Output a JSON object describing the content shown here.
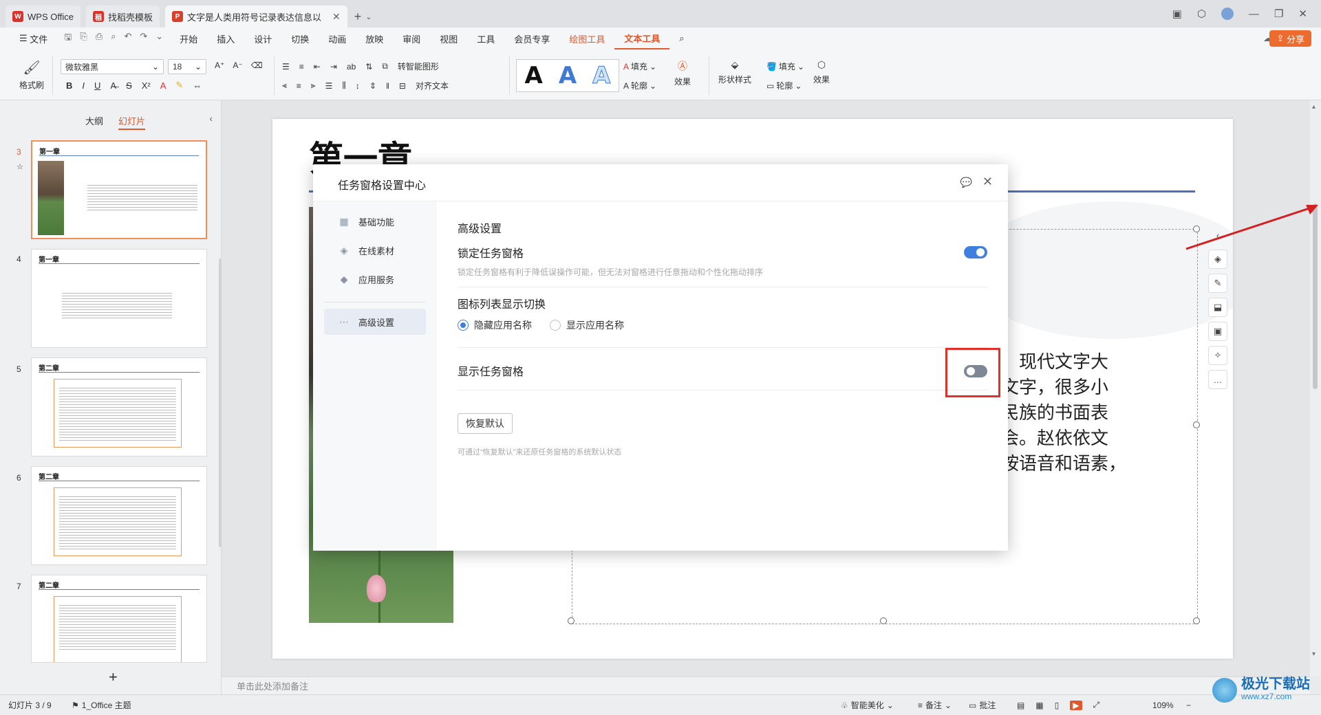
{
  "tabs": [
    {
      "label": "WPS Office",
      "logo": "W",
      "color": "#e0302a"
    },
    {
      "label": "找稻壳模板",
      "logo": "稻",
      "color": "#e0302a"
    },
    {
      "label": "文字是人类用符号记录表达信息以",
      "logo": "P",
      "color": "#d7402a"
    }
  ],
  "menu": {
    "file": "文件",
    "items": [
      "开始",
      "插入",
      "设计",
      "切换",
      "动画",
      "放映",
      "审阅",
      "视图",
      "工具",
      "会员专享"
    ],
    "drawing_tools": "绘图工具",
    "text_tools": "文本工具",
    "share": "分享"
  },
  "ribbon": {
    "format_painter": "格式刷",
    "font_name": "微软雅黑",
    "font_size": "18",
    "to_smart_shape": "转智能图形",
    "align_text": "对齐文本",
    "fill": "填充",
    "outline": "轮廓",
    "effects": "效果",
    "shape_style": "形状样式",
    "fill2": "填充",
    "outline2": "轮廓",
    "effects2": "效果",
    "wordart_letter": "A"
  },
  "left_panel": {
    "tab_outline": "大纲",
    "tab_slides": "幻灯片",
    "thumbs": [
      {
        "num": "3",
        "title": "第一章"
      },
      {
        "num": "4",
        "title": "第一章"
      },
      {
        "num": "5",
        "title": "第二章"
      },
      {
        "num": "6",
        "title": "第二章"
      },
      {
        "num": "7",
        "title": "第二章"
      }
    ]
  },
  "slide": {
    "title": "第一章",
    "body_lines": [
      "式和工具。现代文字大",
      "于生书面文字，很多小",
      "了国家和民族的书面表",
      "的文明社会。赵依依文",
      "言文字。按语音和语素，"
    ]
  },
  "notes_placeholder": "单击此处添加备注",
  "status": {
    "slide_counter": "幻灯片 3 / 9",
    "theme": "1_Office 主题",
    "smart_beautify": "智能美化",
    "notes": "备注",
    "comments": "批注",
    "zoom": "109%"
  },
  "dialog": {
    "title": "任务窗格设置中心",
    "sidebar": [
      {
        "label": "基础功能",
        "icon": "grid-icon"
      },
      {
        "label": "在线素材",
        "icon": "layers-icon"
      },
      {
        "label": "应用服务",
        "icon": "diamond-icon"
      },
      {
        "label": "高级设置",
        "icon": "more-icon"
      }
    ],
    "section_title": "高级设置",
    "lock_label": "锁定任务窗格",
    "lock_desc": "锁定任务窗格有利于降低误操作可能，但无法对窗格进行任意拖动和个性化拖动排序",
    "lock_on": true,
    "icon_toggle_label": "图标列表显示切换",
    "radio_hide": "隐藏应用名称",
    "radio_show": "显示应用名称",
    "show_pane_label": "显示任务窗格",
    "show_pane_on": false,
    "reset_button": "恢复默认",
    "reset_desc": "可通过“恢复默认”来还原任务窗格的系统默认状态"
  },
  "watermark": {
    "big": "极光下载站",
    "small": "www.xz7.com"
  },
  "colors": {
    "accent": "#e0582b",
    "toggle_on": "#3f7fe0",
    "highlight": "#e0302a"
  }
}
